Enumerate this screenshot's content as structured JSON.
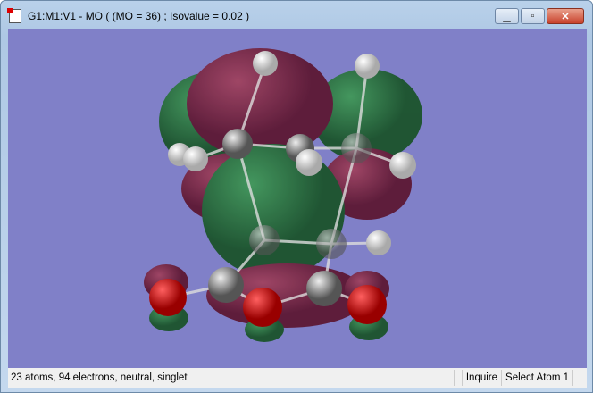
{
  "window": {
    "title": "G1:M1:V1 - MO ( (MO = 36) ; Isovalue = 0.02 )",
    "minimize": "▁",
    "restore": "▫",
    "close": "✕"
  },
  "status": {
    "summary": "23 atoms, 94 electrons, neutral, singlet",
    "mode": "Inquire",
    "action": "Select Atom 1"
  },
  "colors": {
    "background": "#8080c8",
    "positive_lobe": "#1e6a2e",
    "negative_lobe": "#7a1e3a",
    "hydrogen": "#ffffff",
    "carbon": "#9a9a9a",
    "oxygen": "#e00000"
  }
}
